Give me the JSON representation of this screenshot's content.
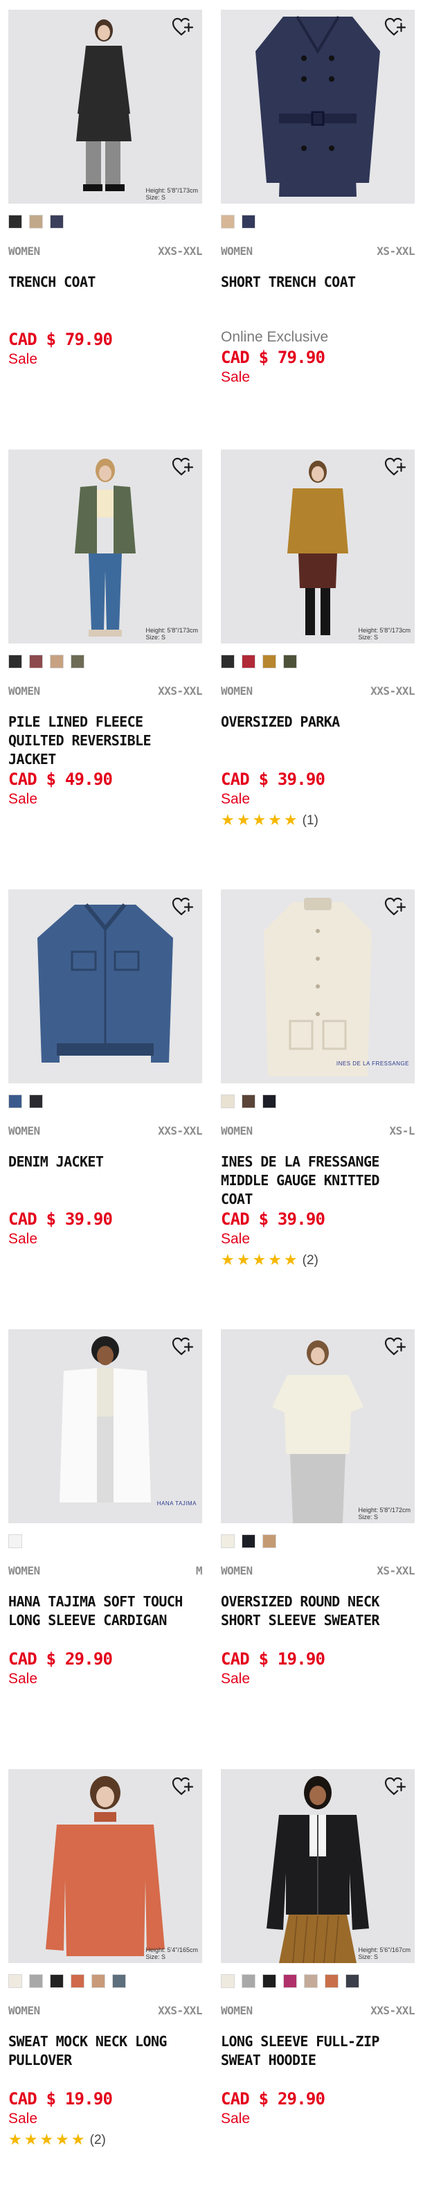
{
  "products": [
    {
      "id": "trench-coat",
      "gender": "WOMEN",
      "size_range": "XXS-XXL",
      "name": "TRENCH COAT",
      "online": "",
      "price": "CAD $ 79.90",
      "sale": "Sale",
      "rating": null,
      "rating_count": "",
      "size_note": "Height: 5'8\"/173cm\nSize: S",
      "swatches": [
        "#2b2b2b",
        "#c2a88a",
        "#3b3f5c"
      ],
      "photo": {
        "bg": "#e4e4e6",
        "garment": "#2a2a2a",
        "accent": "#8a8a8a",
        "skin": "#e7c9b3",
        "hair": "#4a3426",
        "style": "long-coat"
      }
    },
    {
      "id": "short-trench-coat",
      "gender": "WOMEN",
      "size_range": "XS-XXL",
      "name": "SHORT TRENCH COAT",
      "online": "Online Exclusive",
      "price": "CAD $ 79.90",
      "sale": "Sale",
      "rating": null,
      "rating_count": "",
      "size_note": "",
      "swatches": [
        "#d6b696",
        "#333a5c"
      ],
      "photo": {
        "bg": "#e6e6e8",
        "garment": "#2f3656",
        "accent": "#1f2440",
        "skin": "",
        "hair": "",
        "style": "flat-coat"
      }
    },
    {
      "id": "pile-lined-jacket",
      "gender": "WOMEN",
      "size_range": "XXS-XXL",
      "name": "PILE LINED FLEECE QUILTED REVERSIBLE JACKET",
      "online": "",
      "price": "CAD $ 49.90",
      "sale": "Sale",
      "rating": null,
      "rating_count": "",
      "size_note": "Height: 5'8\"/173cm\nSize: S",
      "swatches": [
        "#2d2d2d",
        "#8c4a4e",
        "#c6a182",
        "#6e6b55"
      ],
      "photo": {
        "bg": "#e4e4e6",
        "garment": "#5b6a4e",
        "accent": "#3d6a9c",
        "skin": "#e7c9b3",
        "hair": "#c49a63",
        "style": "jacket-jeans"
      }
    },
    {
      "id": "oversized-parka",
      "gender": "WOMEN",
      "size_range": "XXS-XXL",
      "name": "OVERSIZED PARKA",
      "online": "",
      "price": "CAD $ 39.90",
      "sale": "Sale",
      "rating": "★★★★★",
      "rating_count": "(1)",
      "size_note": "Height: 5'8\"/173cm\nSize: S",
      "swatches": [
        "#2d2d2d",
        "#b02a38",
        "#b7862e",
        "#4e5239"
      ],
      "photo": {
        "bg": "#e4e4e6",
        "garment": "#b3822c",
        "accent": "#5a2a22",
        "skin": "#e7c9b3",
        "hair": "#6a4a2a",
        "style": "parka-skirt"
      }
    },
    {
      "id": "denim-jacket",
      "gender": "WOMEN",
      "size_range": "XXS-XXL",
      "name": "DENIM JACKET",
      "online": "",
      "price": "CAD $ 39.90",
      "sale": "Sale",
      "rating": null,
      "rating_count": "",
      "size_note": "",
      "swatches": [
        "#3b5b8c",
        "#2a2a30"
      ],
      "photo": {
        "bg": "#e6e6e8",
        "garment": "#3e5f8e",
        "accent": "#2c4468",
        "skin": "",
        "hair": "",
        "style": "flat-denim"
      }
    },
    {
      "id": "ines-knitted-coat",
      "gender": "WOMEN",
      "size_range": "XS-L",
      "name": "INES DE LA FRESSANGE MIDDLE GAUGE KNITTED COAT",
      "online": "",
      "price": "CAD $ 39.90",
      "sale": "Sale",
      "rating": "★★★★★",
      "rating_count": "(2)",
      "size_note": "",
      "brand_mark": "INES DE LA FRESSANGE",
      "swatches": [
        "#e9e1d2",
        "#5a4538",
        "#1e1e28"
      ],
      "photo": {
        "bg": "#e6e6e8",
        "garment": "#efe9dc",
        "accent": "#d6cdbb",
        "skin": "",
        "hair": "",
        "style": "flat-knit"
      }
    },
    {
      "id": "hana-tajima-cardigan",
      "gender": "WOMEN",
      "size_range": "M",
      "name": "HANA TAJIMA SOFT TOUCH LONG SLEEVE CARDIGAN",
      "online": "",
      "price": "CAD $ 29.90",
      "sale": "Sale",
      "rating": null,
      "rating_count": "",
      "size_note": "",
      "brand_mark": "HANA TAJIMA",
      "swatches": [
        "#f4f4f4"
      ],
      "photo": {
        "bg": "#e4e4e6",
        "garment": "#fafafa",
        "accent": "#e9e6da",
        "skin": "#8a5a3c",
        "hair": "#1e1e1e",
        "style": "cardigan"
      }
    },
    {
      "id": "oversized-round-neck",
      "gender": "WOMEN",
      "size_range": "XS-XXL",
      "name": "OVERSIZED ROUND NECK SHORT SLEEVE SWEATER",
      "online": "",
      "price": "CAD $ 19.90",
      "sale": "Sale",
      "rating": null,
      "rating_count": "",
      "size_note": "Height: 5'8\"/172cm\nSize: S",
      "swatches": [
        "#f1ede2",
        "#1d1f26",
        "#c49a73"
      ],
      "photo": {
        "bg": "#e4e4e6",
        "garment": "#f2efe0",
        "accent": "#c8c8c8",
        "skin": "#e7c9b3",
        "hair": "#7a5638",
        "style": "tee"
      }
    },
    {
      "id": "sweat-mock-neck",
      "gender": "WOMEN",
      "size_range": "XXS-XXL",
      "name": "SWEAT MOCK NECK LONG PULLOVER",
      "online": "",
      "price": "CAD $ 19.90",
      "sale": "Sale",
      "rating": "★★★★★",
      "rating_count": "(2)",
      "size_note": "Height: 5'4\"/165cm\nSize: S",
      "swatches": [
        "#efeae0",
        "#a8a8a8",
        "#222222",
        "#d06a4b",
        "#c89a7a",
        "#5d6f7c"
      ],
      "photo": {
        "bg": "#e4e4e6",
        "garment": "#d66a4a",
        "accent": "#b85638",
        "skin": "#e7c9b3",
        "hair": "#5a3a24",
        "style": "pullover"
      }
    },
    {
      "id": "full-zip-hoodie",
      "gender": "WOMEN",
      "size_range": "XXS-XXL",
      "name": "LONG SLEEVE FULL-ZIP SWEAT HOODIE",
      "online": "",
      "price": "CAD $ 29.90",
      "sale": "Sale",
      "rating": null,
      "rating_count": "",
      "size_note": "Height: 5'6\"/167cm\nSize: S",
      "swatches": [
        "#efeae0",
        "#a8a8a8",
        "#1e1e1e",
        "#b0306a",
        "#c4aa98",
        "#c9704a",
        "#3b3f4a"
      ],
      "photo": {
        "bg": "#e4e4e6",
        "garment": "#1c1c1e",
        "accent": "#9a6a2a",
        "skin": "#a06a48",
        "hair": "#1a1410",
        "style": "hoodie"
      }
    }
  ],
  "icons": {
    "favorite": "heart-outline-plus-icon",
    "rating": "star-icon"
  },
  "colors": {
    "price": "#e4001b",
    "meta": "#8d8d8d",
    "star": "#f5b800"
  }
}
